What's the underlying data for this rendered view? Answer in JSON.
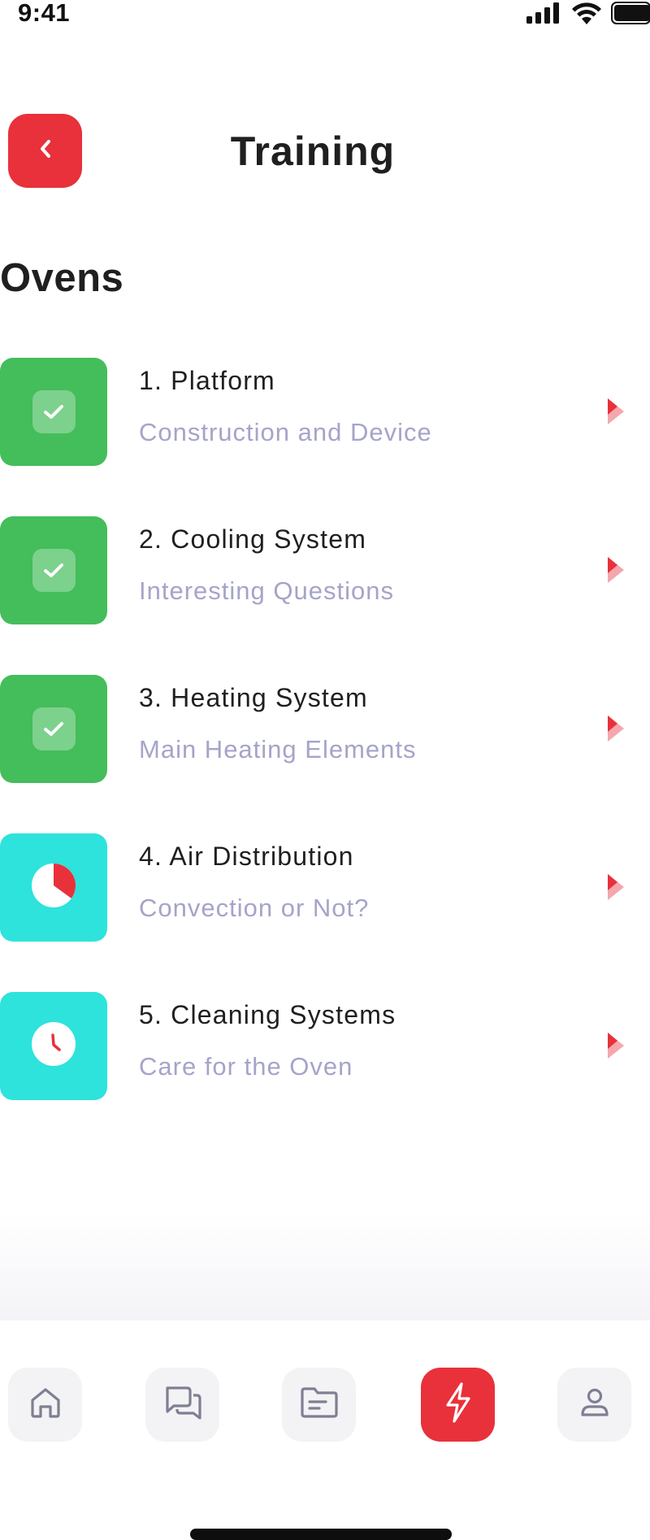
{
  "status_bar": {
    "time": "9:41",
    "icons": [
      "signal-icon",
      "wifi-icon",
      "battery-icon"
    ]
  },
  "header": {
    "title": "Training",
    "back_icon": "chevron-left-icon"
  },
  "section": {
    "title": "Ovens"
  },
  "lessons": [
    {
      "title": "1. Platform",
      "subtitle": "Construction and Device",
      "status": "completed",
      "icon": "check-icon",
      "color": "#44bd5b"
    },
    {
      "title": "2. Cooling System",
      "subtitle": "Interesting Questions",
      "status": "completed",
      "icon": "check-icon",
      "color": "#44bd5b"
    },
    {
      "title": "3. Heating System",
      "subtitle": "Main Heating Elements",
      "status": "completed",
      "icon": "check-icon",
      "color": "#44bd5b"
    },
    {
      "title": "4. Air Distribution",
      "subtitle": "Convection or Not?",
      "status": "in-progress",
      "icon": "pie-progress-icon",
      "progress": 0.35,
      "color": "#2de3dc"
    },
    {
      "title": "5. Cleaning Systems",
      "subtitle": "Care for the Oven",
      "status": "not-started",
      "icon": "clock-icon",
      "color": "#2de3dc"
    }
  ],
  "bottom_nav": {
    "items": [
      {
        "icon": "home-icon",
        "active": false
      },
      {
        "icon": "chat-icon",
        "active": false
      },
      {
        "icon": "folder-icon",
        "active": false
      },
      {
        "icon": "lightning-icon",
        "active": true
      },
      {
        "icon": "profile-icon",
        "active": false
      }
    ]
  },
  "colors": {
    "accent": "#e8313b",
    "completed": "#44bd5b",
    "pending": "#2de3dc",
    "subtitle": "#a5a4c9"
  }
}
